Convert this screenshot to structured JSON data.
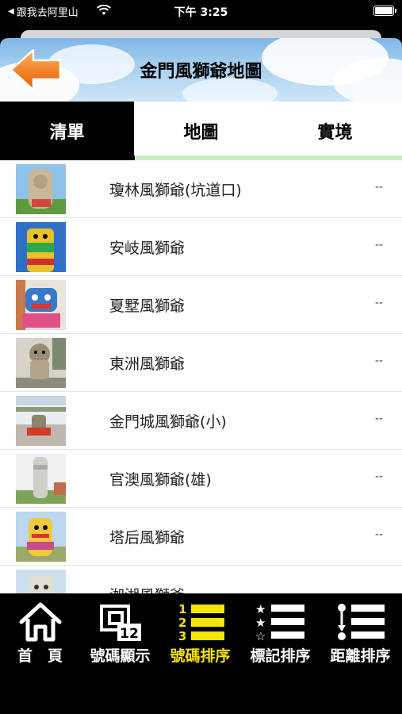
{
  "status_bar": {
    "back_label": "跟我去阿里山",
    "time": "下午 3:25"
  },
  "header": {
    "title": "金門風獅爺地圖",
    "back_icon": "orange-left-arrow-icon"
  },
  "tabs": [
    {
      "label": "清單",
      "active": true
    },
    {
      "label": "地圖",
      "active": false
    },
    {
      "label": "實境",
      "active": false
    }
  ],
  "list": [
    {
      "title": "瓊林風獅爺(坑道口)",
      "distance": "--"
    },
    {
      "title": "安岐風獅爺",
      "distance": "--"
    },
    {
      "title": "夏墅風獅爺",
      "distance": "--"
    },
    {
      "title": "東洲風獅爺",
      "distance": "--"
    },
    {
      "title": "金門城風獅爺(小)",
      "distance": "--"
    },
    {
      "title": "官澳風獅爺(雄)",
      "distance": "--"
    },
    {
      "title": "塔后風獅爺",
      "distance": "--"
    },
    {
      "title": "洳湖風獅爺",
      "distance": ""
    }
  ],
  "toolbar": {
    "home": "首　頁",
    "number_display": "號碼顯示",
    "number_display_icon_text": "12",
    "number_sort": "號碼排序",
    "number_sort_digits": [
      "1",
      "2",
      "3"
    ],
    "mark_sort": "標記排序",
    "distance_sort": "距離排序"
  },
  "colors": {
    "active_tool": "#f5e500",
    "accent_orange": "#f07a1a",
    "tab_underline": "#c5efc0"
  }
}
